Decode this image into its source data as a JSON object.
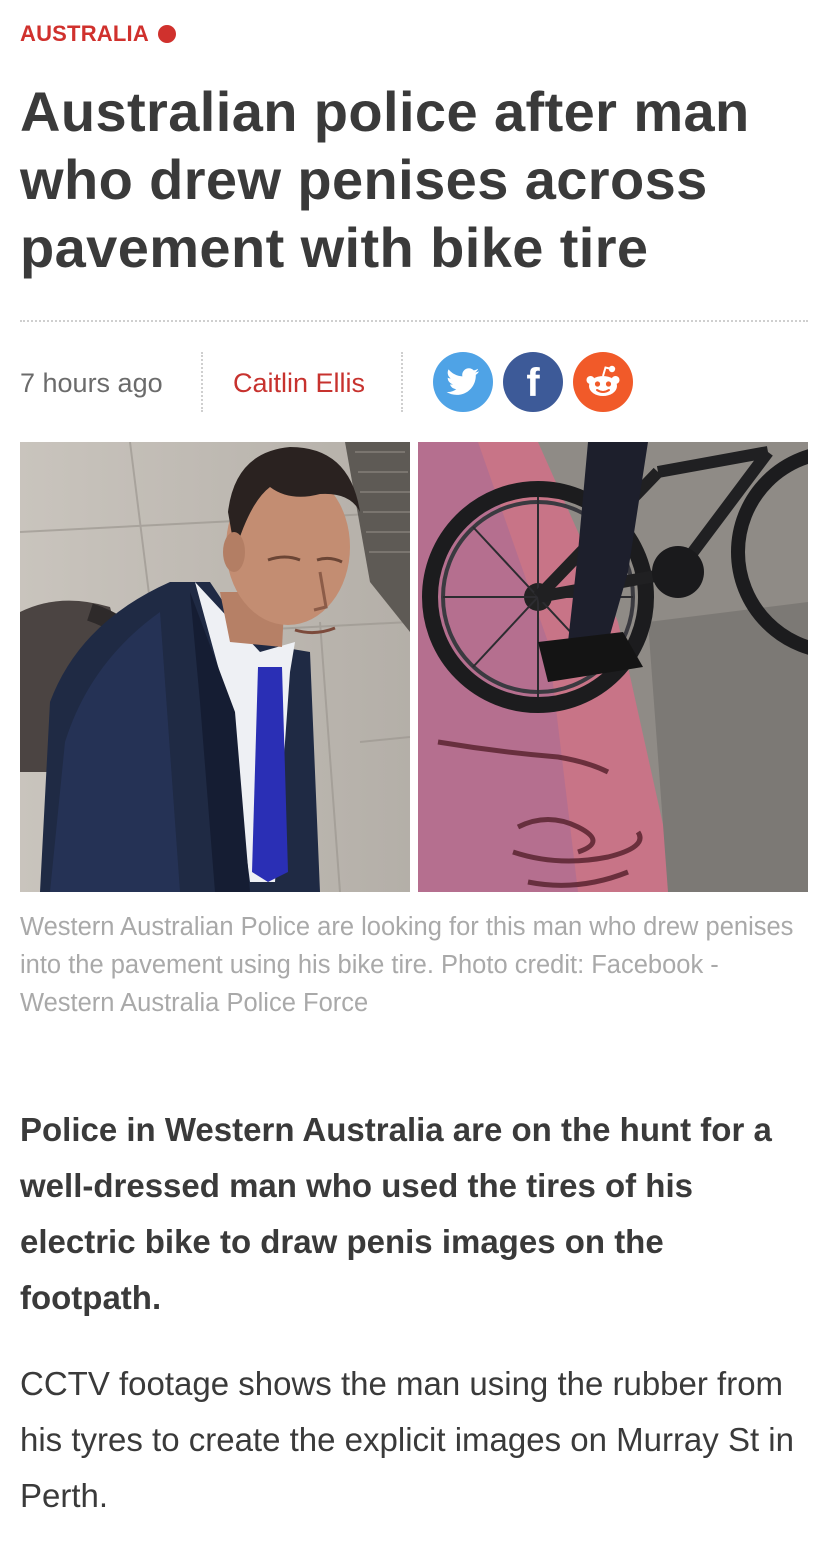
{
  "section": {
    "label": "AUSTRALIA"
  },
  "article": {
    "headline": "Australian police after man who drew penises across pavement with bike tire",
    "time": "7 hours ago",
    "author": "Caitlin Ellis"
  },
  "share": [
    {
      "network": "twitter",
      "icon": "twitter-bird-icon",
      "color": "#4fa3e6"
    },
    {
      "network": "facebook",
      "icon": "facebook-f-icon",
      "glyph": "f",
      "color": "#3d5a98"
    },
    {
      "network": "reddit",
      "icon": "reddit-alien-icon",
      "color": "#f15a29"
    }
  ],
  "images": [
    {
      "subject": "man in suit with backpack"
    },
    {
      "subject": "bike wheel over red painted pavement"
    }
  ],
  "caption": "Western Australian Police are looking for this man who drew penises into the pavement using his bike tire. Photo credit: Facebook - Western Australia Police Force",
  "paragraphs": [
    "Police in Western Australia are on the hunt for a well-dressed man who used the tires of his electric bike to draw penis images on the footpath.",
    "CCTV footage shows the man using the rubber from his tyres to create the explicit images on Murray St in Perth."
  ],
  "colors": {
    "accent": "#d0312d",
    "text": "#3a3a3a",
    "muted": "#6b6b6b",
    "caption": "#a9a9a9"
  }
}
